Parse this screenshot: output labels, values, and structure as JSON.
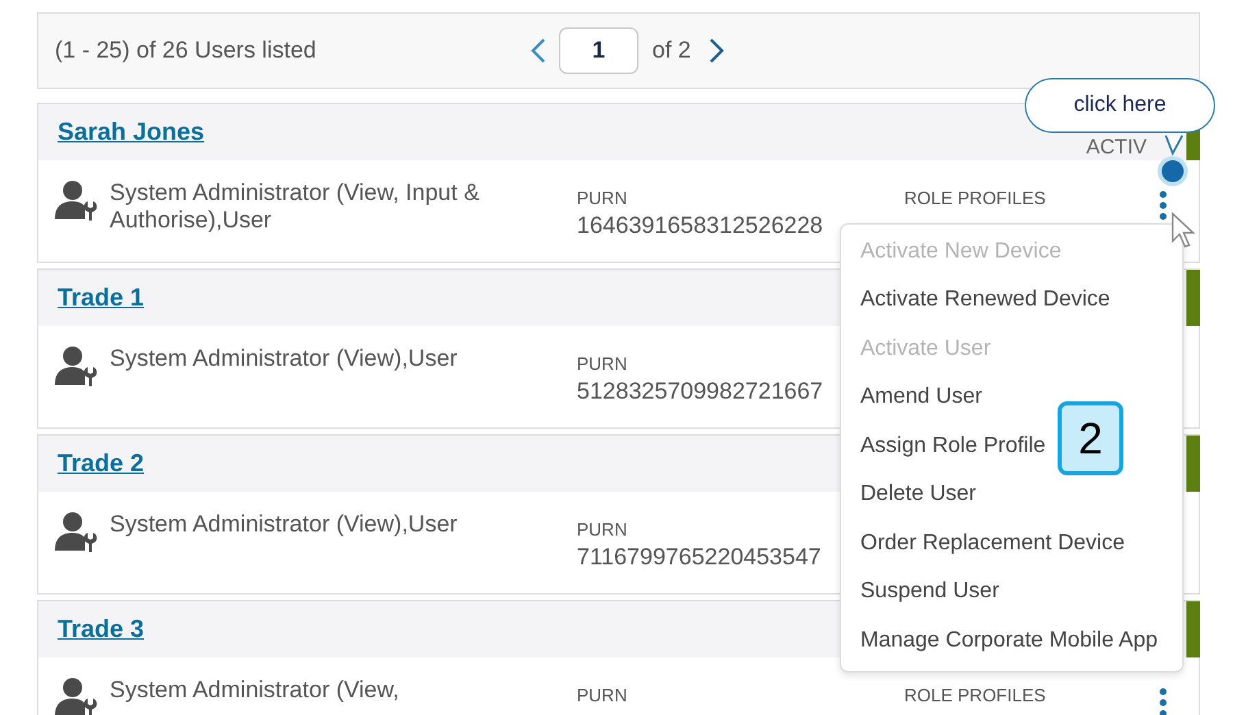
{
  "pager": {
    "summary": "(1 - 25) of 26 Users listed",
    "page": "1",
    "page_count": "of 2"
  },
  "users": [
    {
      "name": "Sarah Jones",
      "status": "ACTIV",
      "role": "System Administrator (View, Input & Authorise),User",
      "purn_label": "PURN",
      "purn": "1646391658312526228",
      "role_profiles_label": "ROLE PROFILES",
      "actions_button": true
    },
    {
      "name": "Trade 1",
      "role": "System Administrator (View),User",
      "purn_label": "PURN",
      "purn": "5128325709982721667"
    },
    {
      "name": "Trade 2",
      "role": "System Administrator (View),User",
      "purn_label": "PURN",
      "purn": "7116799765220453547"
    },
    {
      "name": "Trade 3",
      "role": "System Administrator (View,",
      "purn_label": "PURN",
      "role_profiles_label": "ROLE PROFILES",
      "actions_button": true
    }
  ],
  "menu": {
    "items": [
      {
        "label": "Activate New Device",
        "disabled": true
      },
      {
        "label": "Activate Renewed Device",
        "disabled": false
      },
      {
        "label": "Activate User",
        "disabled": true
      },
      {
        "label": "Amend User",
        "disabled": false
      },
      {
        "label": "Assign Role Profile",
        "disabled": false
      },
      {
        "label": "Delete User",
        "disabled": false
      },
      {
        "label": "Order Replacement Device",
        "disabled": false
      },
      {
        "label": "Suspend User",
        "disabled": false
      },
      {
        "label": "Manage Corporate Mobile App",
        "disabled": false
      }
    ]
  },
  "callout": {
    "text": "click here"
  },
  "step_badge": {
    "text": "2"
  }
}
